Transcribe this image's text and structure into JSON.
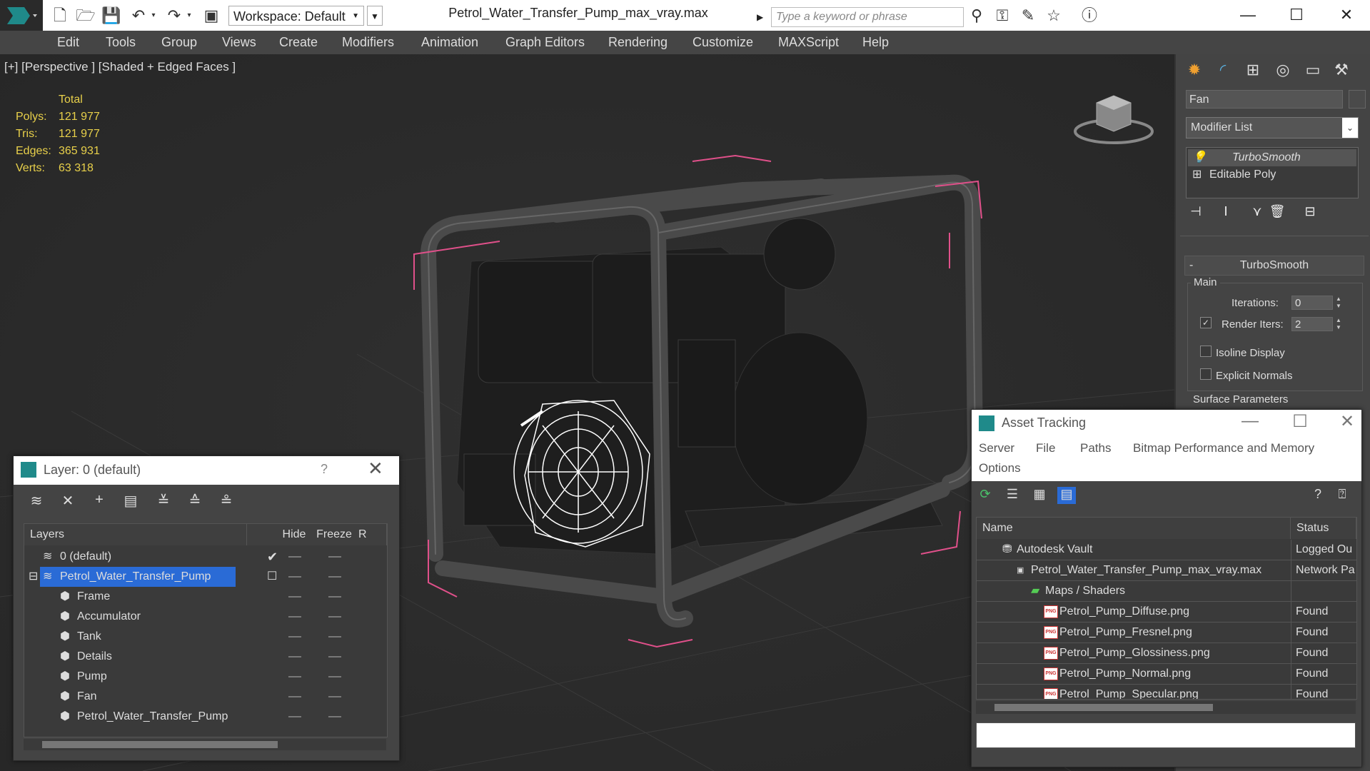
{
  "titlebar": {
    "workspace": "Workspace: Default",
    "document_title": "Petrol_Water_Transfer_Pump_max_vray.max",
    "search_placeholder": "Type a keyword or phrase"
  },
  "menu": [
    "Edit",
    "Tools",
    "Group",
    "Views",
    "Create",
    "Modifiers",
    "Animation",
    "Graph Editors",
    "Rendering",
    "Customize",
    "MAXScript",
    "Help"
  ],
  "viewport": {
    "label": "[+] [Perspective ] [Shaded + Edged Faces ]",
    "stats": {
      "header": "Total",
      "rows": [
        {
          "label": "Polys:",
          "value": "121 977"
        },
        {
          "label": "Tris:",
          "value": "121 977"
        },
        {
          "label": "Edges:",
          "value": "365 931"
        },
        {
          "label": "Verts:",
          "value": "63 318"
        }
      ]
    }
  },
  "command_panel": {
    "object_name": "Fan",
    "modifier_list": "Modifier List",
    "stack": [
      "TurboSmooth",
      "Editable Poly"
    ],
    "rollout_title": "TurboSmooth",
    "main_group": "Main",
    "iterations_label": "Iterations:",
    "iterations_value": "0",
    "render_iters_label": "Render Iters:",
    "render_iters_value": "2",
    "isoline_label": "Isoline Display",
    "explicit_normals_label": "Explicit Normals",
    "surface_params_label": "Surface Parameters"
  },
  "layer_window": {
    "title": "Layer: 0 (default)",
    "help": "?",
    "columns": [
      "Layers",
      "Hide",
      "Freeze",
      "R"
    ],
    "rows": [
      {
        "name": "0 (default)",
        "indent": 1,
        "current": true
      },
      {
        "name": "Petrol_Water_Transfer_Pump",
        "indent": 1,
        "selected": true
      },
      {
        "name": "Frame",
        "indent": 2
      },
      {
        "name": "Accumulator",
        "indent": 2
      },
      {
        "name": "Tank",
        "indent": 2
      },
      {
        "name": "Details",
        "indent": 2
      },
      {
        "name": "Pump",
        "indent": 2
      },
      {
        "name": "Fan",
        "indent": 2
      },
      {
        "name": "Petrol_Water_Transfer_Pump",
        "indent": 2
      }
    ]
  },
  "asset_window": {
    "title": "Asset Tracking",
    "menu": [
      "Server",
      "File",
      "Paths",
      "Bitmap Performance and Memory",
      "Options"
    ],
    "columns": [
      "Name",
      "Status"
    ],
    "rows": [
      {
        "name": "Autodesk Vault",
        "status": "Logged Ou",
        "level": 1
      },
      {
        "name": "Petrol_Water_Transfer_Pump_max_vray.max",
        "status": "Network Pa",
        "level": 2
      },
      {
        "name": "Maps / Shaders",
        "status": "",
        "level": 3
      },
      {
        "name": "Petrol_Pump_Diffuse.png",
        "status": "Found",
        "level": 4
      },
      {
        "name": "Petrol_Pump_Fresnel.png",
        "status": "Found",
        "level": 4
      },
      {
        "name": "Petrol_Pump_Glossiness.png",
        "status": "Found",
        "level": 4
      },
      {
        "name": "Petrol_Pump_Normal.png",
        "status": "Found",
        "level": 4
      },
      {
        "name": "Petrol_Pump_Specular.png",
        "status": "Found",
        "level": 4
      }
    ]
  },
  "colors": {
    "accent_selected": "#2a6bd6",
    "stats_text": "#e8d04a",
    "bbox_pink": "#e0508a"
  }
}
